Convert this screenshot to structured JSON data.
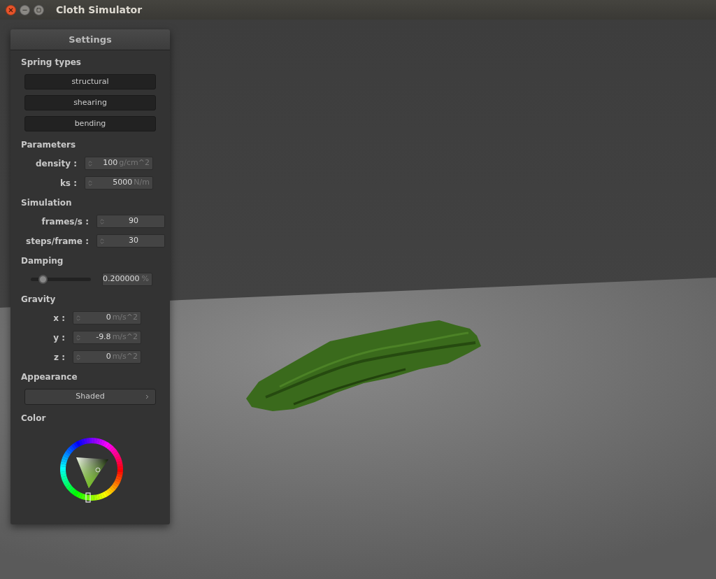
{
  "window": {
    "title": "Cloth Simulator"
  },
  "panel": {
    "title": "Settings",
    "sections": [
      {
        "kind": "buttons",
        "title": "Spring types",
        "buttons": [
          "structural",
          "shearing",
          "bending"
        ]
      },
      {
        "kind": "fields",
        "title": "Parameters",
        "fields": [
          {
            "label": "density :",
            "value": "100",
            "unit": "g/cm^2"
          },
          {
            "label": "ks :",
            "value": "5000",
            "unit": "N/m"
          }
        ]
      },
      {
        "kind": "fields",
        "title": "Simulation",
        "fields": [
          {
            "label": "frames/s :",
            "value": "90"
          },
          {
            "label": "steps/frame :",
            "value": "30"
          }
        ]
      },
      {
        "kind": "slider",
        "title": "Damping",
        "level": 0.2,
        "value": "0.200000",
        "unit": "%"
      },
      {
        "kind": "fields",
        "title": "Gravity",
        "fields": [
          {
            "label": "x :",
            "value": "0",
            "unit": "m/s^2"
          },
          {
            "label": "y :",
            "value": "-9.8",
            "unit": "m/s^2"
          },
          {
            "label": "z :",
            "value": "0",
            "unit": "m/s^2"
          }
        ]
      },
      {
        "kind": "dropdown",
        "title": "Appearance",
        "value": "Shaded"
      },
      {
        "kind": "color_wheel",
        "title": "Color"
      }
    ]
  }
}
